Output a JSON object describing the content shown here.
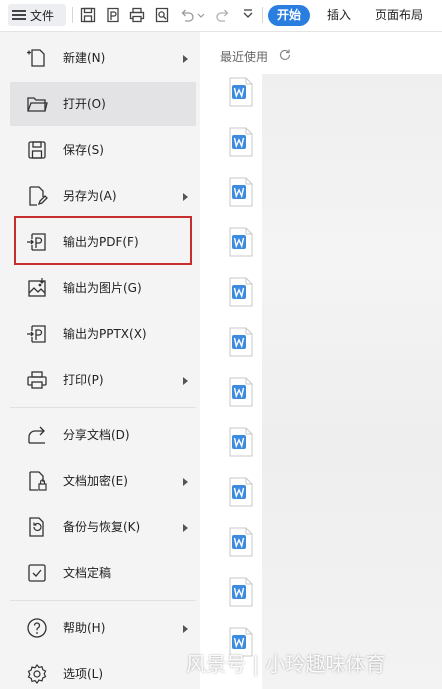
{
  "toolbar": {
    "file_label": "文件",
    "tab_start": "开始",
    "tab_insert": "插入",
    "tab_layout": "页面布局"
  },
  "menu": {
    "items": [
      {
        "label": "新建(N)",
        "icon": "new-file-icon",
        "has_submenu": true
      },
      {
        "label": "打开(O)",
        "icon": "open-folder-icon",
        "has_submenu": false,
        "active": true
      },
      {
        "label": "保存(S)",
        "icon": "save-icon",
        "has_submenu": false
      },
      {
        "label": "另存为(A)",
        "icon": "save-as-icon",
        "has_submenu": true
      },
      {
        "label": "输出为PDF(F)",
        "icon": "export-pdf-icon",
        "has_submenu": false,
        "highlighted": true
      },
      {
        "label": "输出为图片(G)",
        "icon": "export-image-icon",
        "has_submenu": false
      },
      {
        "label": "输出为PPTX(X)",
        "icon": "export-pptx-icon",
        "has_submenu": false
      },
      {
        "label": "打印(P)",
        "icon": "print-icon",
        "has_submenu": true
      },
      {
        "label": "分享文档(D)",
        "icon": "share-icon",
        "has_submenu": false
      },
      {
        "label": "文档加密(E)",
        "icon": "encrypt-icon",
        "has_submenu": true
      },
      {
        "label": "备份与恢复(K)",
        "icon": "backup-icon",
        "has_submenu": true
      },
      {
        "label": "文档定稿",
        "icon": "finalize-icon",
        "has_submenu": false
      },
      {
        "label": "帮助(H)",
        "icon": "help-icon",
        "has_submenu": true
      },
      {
        "label": "选项(L)",
        "icon": "options-gear-icon",
        "has_submenu": false
      }
    ]
  },
  "recent": {
    "title": "最近使用"
  },
  "watermark": "风景号 | 小玲趣味体育",
  "colors": {
    "accent": "#2a7ee0",
    "highlight_border": "#c62d2d",
    "doc_icon_blue": "#3d8bdf"
  }
}
